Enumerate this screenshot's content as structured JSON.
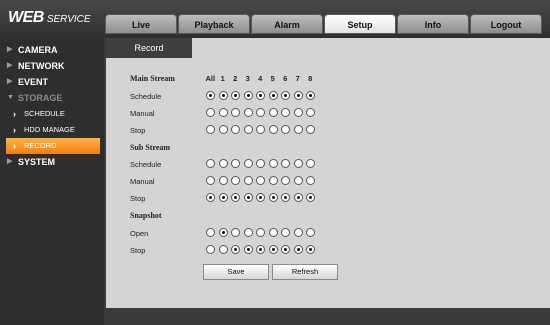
{
  "logo": {
    "web": "WEB",
    "service": "SERVICE"
  },
  "tabs": [
    {
      "label": "Live"
    },
    {
      "label": "Playback"
    },
    {
      "label": "Alarm"
    },
    {
      "label": "Setup",
      "active": true
    },
    {
      "label": "Info"
    },
    {
      "label": "Logout"
    }
  ],
  "sidebar": {
    "items": [
      {
        "label": "CAMERA"
      },
      {
        "label": "NETWORK"
      },
      {
        "label": "EVENT"
      },
      {
        "label": "STORAGE"
      },
      {
        "label": "SCHEDULE"
      },
      {
        "label": "HDD MANAGE"
      },
      {
        "label": "RECORD"
      },
      {
        "label": "SYSTEM"
      }
    ]
  },
  "subtab": "Record",
  "columns": [
    "All",
    "1",
    "2",
    "3",
    "4",
    "5",
    "6",
    "7",
    "8"
  ],
  "sections": {
    "main_stream": "Main Stream",
    "sub_stream": "Sub Stream",
    "snapshot": "Snapshot"
  },
  "rows": {
    "main_schedule": {
      "label": "Schedule",
      "checked": [
        1,
        1,
        1,
        1,
        1,
        1,
        1,
        1,
        1
      ]
    },
    "main_manual": {
      "label": "Manual",
      "checked": [
        0,
        0,
        0,
        0,
        0,
        0,
        0,
        0,
        0
      ]
    },
    "main_stop": {
      "label": "Stop",
      "checked": [
        0,
        0,
        0,
        0,
        0,
        0,
        0,
        0,
        0
      ]
    },
    "sub_schedule": {
      "label": "Schedule",
      "checked": [
        0,
        0,
        0,
        0,
        0,
        0,
        0,
        0,
        0
      ]
    },
    "sub_manual": {
      "label": "Manual",
      "checked": [
        0,
        0,
        0,
        0,
        0,
        0,
        0,
        0,
        0
      ]
    },
    "sub_stop": {
      "label": "Stop",
      "checked": [
        1,
        1,
        1,
        1,
        1,
        1,
        1,
        1,
        1
      ]
    },
    "snap_open": {
      "label": "Open",
      "checked": [
        0,
        1,
        0,
        0,
        0,
        0,
        0,
        0,
        0
      ]
    },
    "snap_stop": {
      "label": "Stop",
      "checked": [
        0,
        0,
        1,
        1,
        1,
        1,
        1,
        1,
        1
      ]
    }
  },
  "buttons": {
    "save": "Save",
    "refresh": "Refresh"
  }
}
